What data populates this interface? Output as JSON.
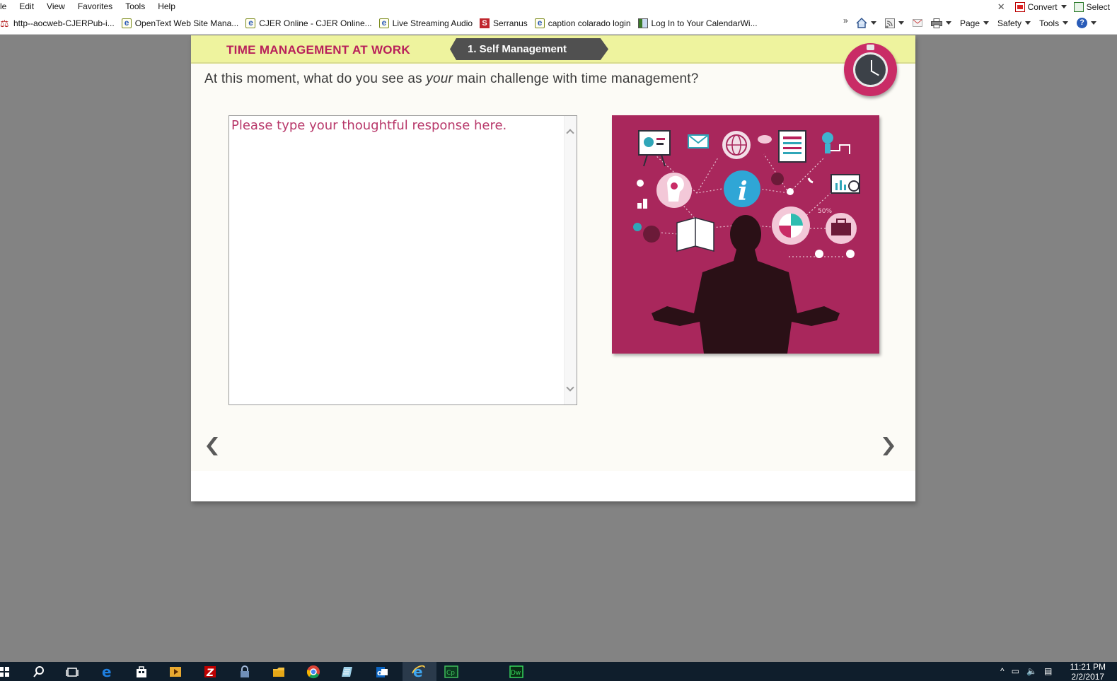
{
  "menubar": {
    "items": [
      "le",
      "Edit",
      "View",
      "Favorites",
      "Tools",
      "Help"
    ],
    "convert_label": "Convert",
    "select_label": "Select"
  },
  "favorites": {
    "items": [
      {
        "label": "http--aocweb-CJERPub-i...",
        "icon": "scale-icon"
      },
      {
        "label": "OpenText Web Site Mana...",
        "icon": "ie-page-icon"
      },
      {
        "label": "CJER Online - CJER Online...",
        "icon": "ie-page-icon"
      },
      {
        "label": "Live Streaming Audio",
        "icon": "ie-page-icon"
      },
      {
        "label": "Serranus",
        "icon": "serranus-icon"
      },
      {
        "label": "caption colarado login",
        "icon": "ie-page-icon"
      },
      {
        "label": "Log In to Your CalendarWi...",
        "icon": "calendarwiz-icon"
      }
    ],
    "overflow": "»"
  },
  "commandbar": {
    "page": "Page",
    "safety": "Safety",
    "tools": "Tools"
  },
  "course": {
    "title": "TIME MANAGEMENT AT WORK",
    "section": "1. Self Management",
    "question_before": "At this moment, what do you see as ",
    "question_emphasis": "your",
    "question_after": " main challenge with time management?",
    "answer_placeholder": "Please type your thoughtful response here.",
    "illustration_percent": "50%",
    "colors": {
      "header_bg": "#eef39e",
      "title": "#b8205a",
      "tab_bg": "#505050",
      "illustration_bg": "#a9275c"
    }
  },
  "taskbar": {
    "time": "11:21 PM",
    "date": "2/2/2017",
    "apps": [
      "windows-start-icon",
      "search-icon",
      "task-view-icon",
      "edge-icon",
      "store-icon",
      "media-icon",
      "filezilla-icon",
      "lock-icon",
      "file-explorer-icon",
      "chrome-icon",
      "notepad-icon",
      "outlook-icon",
      "internet-explorer-icon",
      "captivate-icon",
      "dreamweaver-icon"
    ]
  }
}
